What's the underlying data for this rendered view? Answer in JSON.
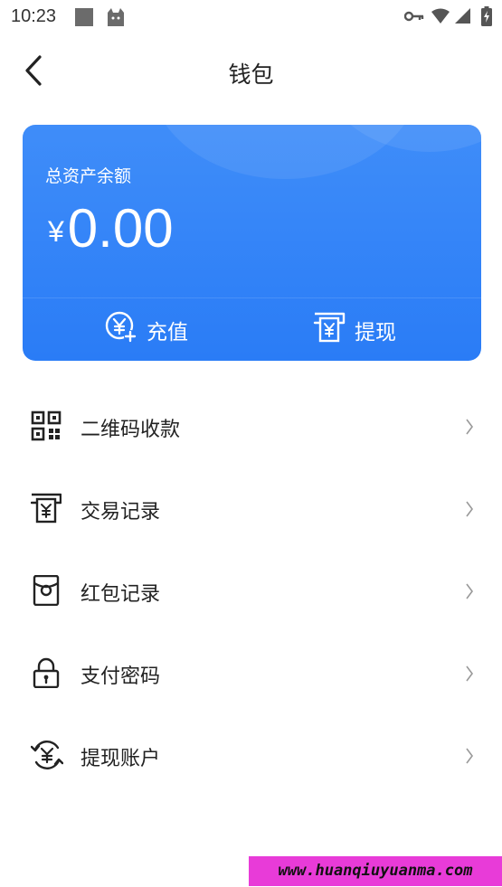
{
  "status_bar": {
    "time": "10:23",
    "left_icons": [
      "notification-square-icon",
      "app-cat-icon"
    ],
    "right_icons": [
      "vpn-key-icon",
      "wifi-icon",
      "cell-signal-icon",
      "battery-charging-icon"
    ]
  },
  "nav": {
    "title": "钱包",
    "back_icon": "chevron-left-icon"
  },
  "card": {
    "label": "总资产余额",
    "currency": "¥",
    "amount": "0.00",
    "colors": {
      "top": "#3f8df9",
      "bottom": "#2a7cf6"
    },
    "actions": [
      {
        "label": "充值",
        "icon": "yuan-add-icon"
      },
      {
        "label": "提现",
        "icon": "yuan-withdraw-icon"
      }
    ]
  },
  "menu": [
    {
      "label": "二维码收款",
      "icon": "qr-code-icon"
    },
    {
      "label": "交易记录",
      "icon": "transaction-record-icon"
    },
    {
      "label": "红包记录",
      "icon": "red-packet-icon"
    },
    {
      "label": "支付密码",
      "icon": "lock-icon"
    },
    {
      "label": "提现账户",
      "icon": "account-exchange-icon"
    }
  ],
  "watermark": "www.huanqiuyuanma.com",
  "colors": {
    "accent": "#2a7cf6",
    "text": "#222222",
    "chevron": "#999999"
  }
}
